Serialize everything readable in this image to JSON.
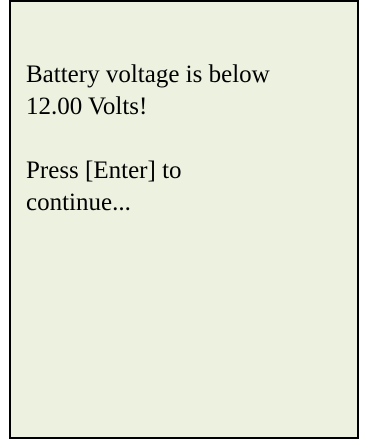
{
  "colors": {
    "screen_background": "#edf2e0",
    "border": "#000000",
    "text": "#000000"
  },
  "screen": {
    "warning_line_1": "Battery voltage is below",
    "warning_line_2": "12.00 Volts!",
    "prompt_line_1": "Press [Enter] to",
    "prompt_line_2": "continue..."
  }
}
